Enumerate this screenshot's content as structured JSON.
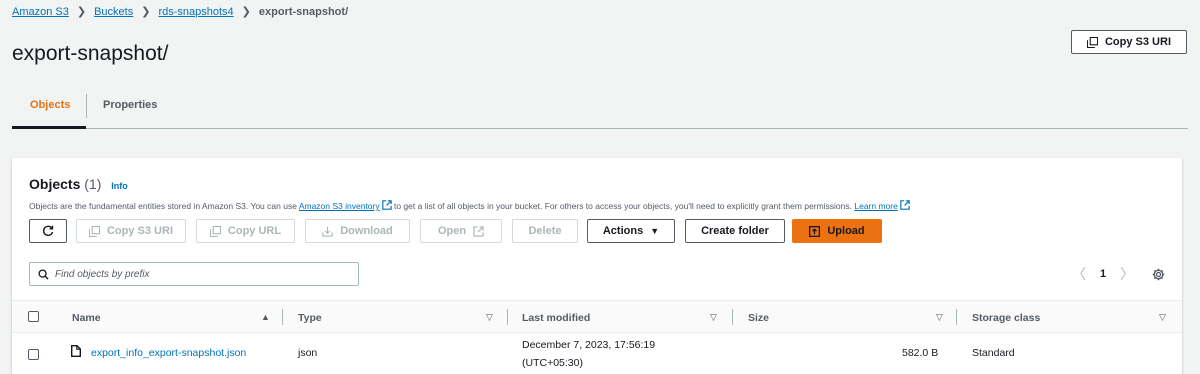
{
  "breadcrumb": {
    "items": [
      "Amazon S3",
      "Buckets",
      "rds-snapshots4"
    ],
    "current": "export-snapshot/",
    "separator": ">"
  },
  "page": {
    "title": "export-snapshot/",
    "copy_uri_label": "Copy S3 URI"
  },
  "tabs": [
    {
      "label": "Objects",
      "active": true
    },
    {
      "label": "Properties",
      "active": false
    }
  ],
  "objects_panel": {
    "title": "Objects",
    "count": "(1)",
    "info": "Info",
    "desc_pre": "Objects are the fundamental entities stored in Amazon S3. You can use ",
    "desc_link": "Amazon S3 inventory",
    "desc_mid": " to get a list of all objects in your bucket. For others to access your objects, you'll need to explicitly grant them permissions. ",
    "desc_learn": "Learn more"
  },
  "toolbar": {
    "copy_s3_uri": "Copy S3 URI",
    "copy_url": "Copy URL",
    "download": "Download",
    "open": "Open",
    "delete": "Delete",
    "actions": "Actions",
    "create_folder": "Create folder",
    "upload": "Upload"
  },
  "search": {
    "placeholder": "Find objects by prefix"
  },
  "pagination": {
    "current_page": "1"
  },
  "table": {
    "columns": [
      "Name",
      "Type",
      "Last modified",
      "Size",
      "Storage class"
    ],
    "rows": [
      {
        "name": "export_info_export-snapshot.json",
        "type": "json",
        "last_modified_line1": "December 7, 2023, 17:56:19",
        "last_modified_line2": "(UTC+05:30)",
        "size": "582.0 B",
        "storage_class": "Standard"
      }
    ]
  },
  "colors": {
    "link": "#0073bb",
    "accent": "#ec7211",
    "background": "#f2f3f3"
  }
}
